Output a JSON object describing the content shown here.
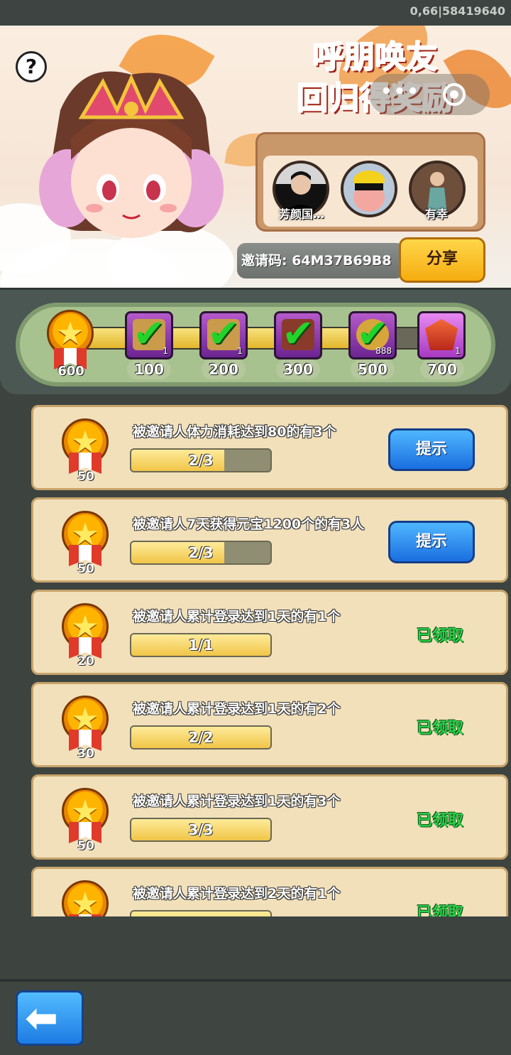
{
  "status_bar": {
    "build_info": "0,66|58419640"
  },
  "banner": {
    "title_line1": "呼朋唤友",
    "title_line2": "回归得奖励",
    "help_label": "?",
    "invited_friends": [
      {
        "name": "芳颜国…"
      },
      {
        "name": ""
      },
      {
        "name": "有幸"
      }
    ],
    "invite_code": "邀请码: 64M37B69B8",
    "share_label": "分享"
  },
  "progress": {
    "current_points": "600",
    "fill_fraction": 0.88,
    "milestones": [
      {
        "label": "100",
        "count": "1",
        "claimed": true
      },
      {
        "label": "200",
        "count": "1",
        "claimed": true
      },
      {
        "label": "300",
        "count": "",
        "claimed": true
      },
      {
        "label": "500",
        "count": "888",
        "claimed": true
      },
      {
        "label": "700",
        "count": "1",
        "claimed": false
      }
    ]
  },
  "tasks": [
    {
      "reward": "50",
      "desc": "被邀请人体力消耗达到80的有3个",
      "progress": "2/3",
      "fraction": 0.667,
      "action": "提示",
      "state": "hint"
    },
    {
      "reward": "50",
      "desc": "被邀请人7天获得元宝1200个的有3人",
      "progress": "2/3",
      "fraction": 0.667,
      "action": "提示",
      "state": "hint"
    },
    {
      "reward": "20",
      "desc": "被邀请人累计登录达到1天的有1个",
      "progress": "1/1",
      "fraction": 1.0,
      "action": "已领取",
      "state": "claimed"
    },
    {
      "reward": "30",
      "desc": "被邀请人累计登录达到1天的有2个",
      "progress": "2/2",
      "fraction": 1.0,
      "action": "已领取",
      "state": "claimed"
    },
    {
      "reward": "50",
      "desc": "被邀请人累计登录达到1天的有3个",
      "progress": "3/3",
      "fraction": 1.0,
      "action": "已领取",
      "state": "claimed"
    },
    {
      "reward": "",
      "desc": "被邀请人累计登录达到2天的有1个",
      "progress": "",
      "fraction": 1.0,
      "action": "已领取",
      "state": "claimed"
    }
  ],
  "footer": {
    "back_icon": "back-arrow-icon"
  }
}
